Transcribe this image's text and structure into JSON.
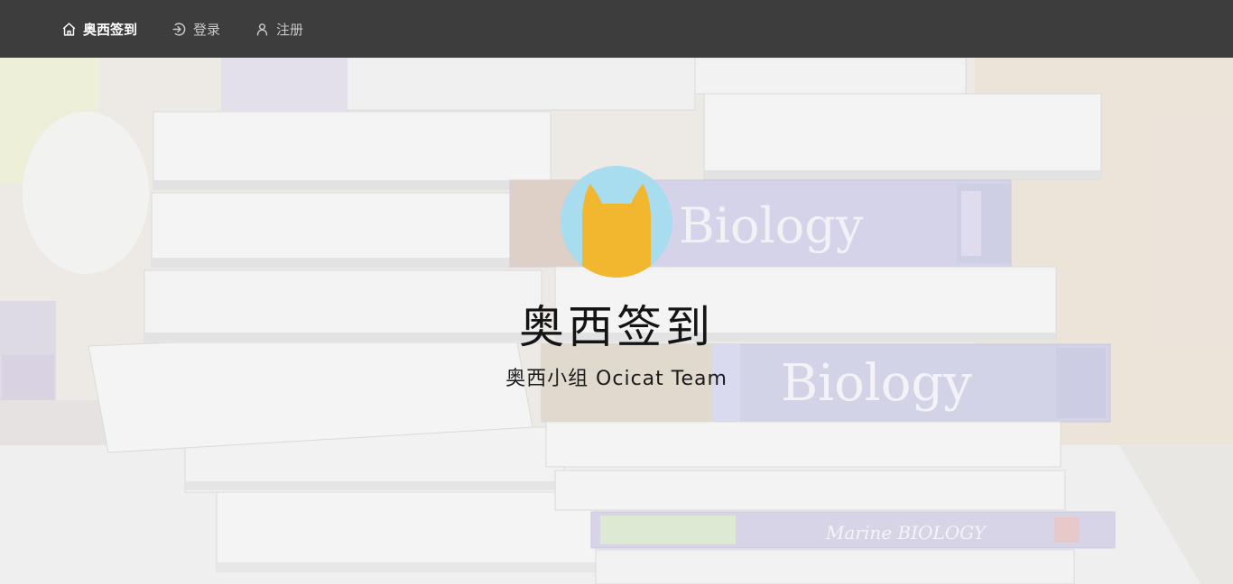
{
  "nav": {
    "home_label": "奥西签到",
    "login_label": "登录",
    "register_label": "注册",
    "icons": {
      "home": "home-icon",
      "login": "login-icon",
      "register": "user-icon"
    }
  },
  "hero": {
    "title": "奥西签到",
    "subtitle": "奥西小组 Ocicat Team",
    "background": "photo-of-stacked-textbooks",
    "book_labels": [
      "Biology",
      "Biology",
      "Marine BIOLOGY"
    ]
  },
  "colors": {
    "navbar": "#3d3d3d",
    "logo_circle": "#a8dcef",
    "logo_cat": "#f0b72f"
  }
}
